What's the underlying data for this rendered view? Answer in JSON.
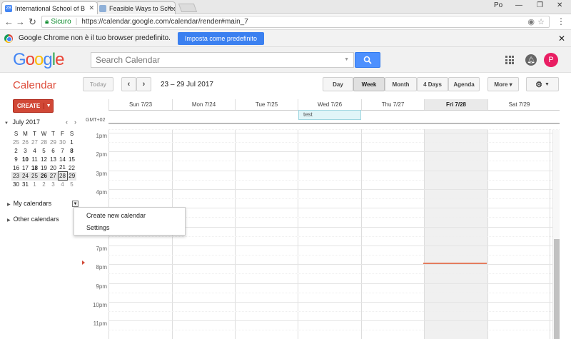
{
  "browser": {
    "tabs": [
      {
        "title": "International School of B",
        "favicon": "calendar-favicon"
      },
      {
        "title": "Feasible Ways to Screen",
        "favicon": "page-favicon"
      }
    ],
    "window_user": "Po",
    "address": {
      "secure_label": "Sicuro",
      "url": "https://calendar.google.com/calendar/render#main_7"
    },
    "infobar": {
      "message": "Google Chrome non è il tuo browser predefinito.",
      "button": "Imposta come predefinito"
    }
  },
  "header": {
    "logo": "Google",
    "search_placeholder": "Search Calendar",
    "avatar_letter": "P"
  },
  "toolbar": {
    "app_title": "Calendar",
    "today": "Today",
    "date_range": "23 – 29 Jul 2017",
    "views": [
      "Day",
      "Week",
      "Month",
      "4 Days",
      "Agenda"
    ],
    "selected_view": "Week",
    "more": "More ▾",
    "settings_icon": "gear-icon"
  },
  "sidebar": {
    "create": "CREATE",
    "month_label": "July 2017",
    "weekdays": [
      "S",
      "M",
      "T",
      "W",
      "T",
      "F",
      "S"
    ],
    "weeks": [
      [
        "25",
        "26",
        "27",
        "28",
        "29",
        "30",
        "1"
      ],
      [
        "2",
        "3",
        "4",
        "5",
        "6",
        "7",
        "8"
      ],
      [
        "9",
        "10",
        "11",
        "12",
        "13",
        "14",
        "15"
      ],
      [
        "16",
        "17",
        "18",
        "19",
        "20",
        "21",
        "22"
      ],
      [
        "23",
        "24",
        "25",
        "26",
        "27",
        "28",
        "29"
      ],
      [
        "30",
        "31",
        "1",
        "2",
        "3",
        "4",
        "5"
      ]
    ],
    "my_calendars": "My calendars",
    "other_calendars": "Other calendars",
    "popup": {
      "create_new": "Create new calendar",
      "settings": "Settings"
    }
  },
  "grid": {
    "timezone": "GMT+02",
    "days": [
      "Sun 7/23",
      "Mon 7/24",
      "Tue 7/25",
      "Wed 7/26",
      "Thu 7/27",
      "Fri 7/28",
      "Sat 7/29"
    ],
    "today_index": 5,
    "event": {
      "title": "test",
      "day": "Wed 7/26"
    },
    "hours": [
      "1pm",
      "2pm",
      "3pm",
      "4pm",
      "5pm",
      "6pm",
      "7pm",
      "8pm",
      "9pm",
      "10pm",
      "11pm"
    ]
  },
  "colors": {
    "accent_red": "#d14836",
    "search_blue": "#4d90fe",
    "now_line": "#e47c5e",
    "event_bg": "#e1f5f8"
  }
}
